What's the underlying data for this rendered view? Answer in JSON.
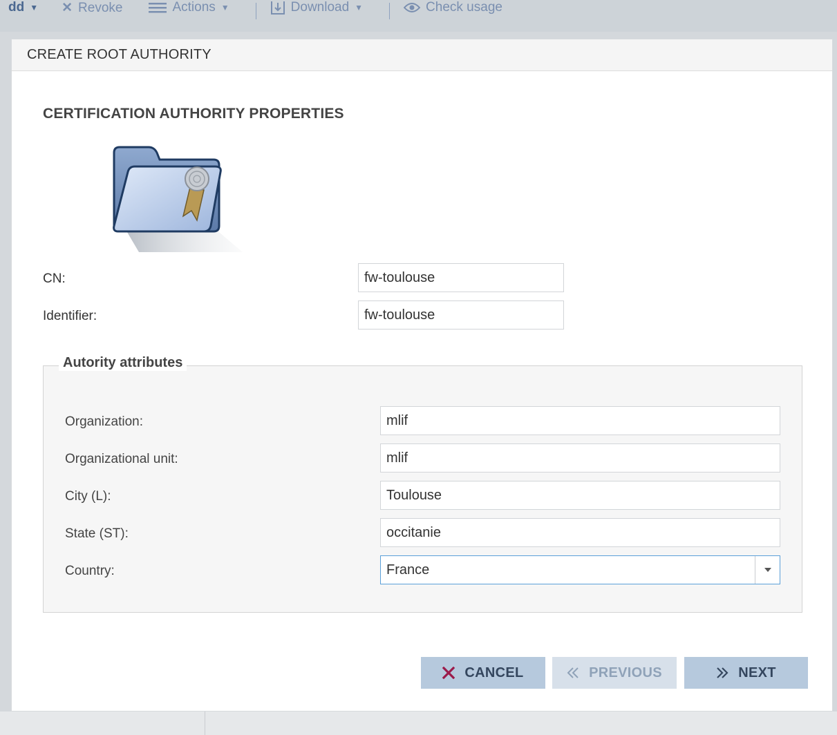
{
  "toolbar": {
    "add_label": "dd",
    "revoke_label": "Revoke",
    "actions_label": "Actions",
    "download_label": "Download",
    "check_usage_label": "Check usage"
  },
  "dialog": {
    "title": "CREATE ROOT AUTHORITY",
    "section_title": "CERTIFICATION AUTHORITY PROPERTIES",
    "icon": "certificate-folder-icon",
    "cn_label": "CN:",
    "cn_value": "fw-toulouse",
    "identifier_label": "Identifier:",
    "identifier_value": "fw-toulouse",
    "attributes": {
      "legend": "Autority attributes",
      "organization_label": "Organization:",
      "organization_value": "mlif",
      "org_unit_label": "Organizational unit:",
      "org_unit_value": "mlif",
      "city_label": "City (L):",
      "city_value": "Toulouse",
      "state_label": "State (ST):",
      "state_value": "occitanie",
      "country_label": "Country:",
      "country_value": "France"
    },
    "buttons": {
      "cancel": "CANCEL",
      "previous": "PREVIOUS",
      "next": "NEXT"
    }
  },
  "colors": {
    "accent_button": "#b6c9dd",
    "disabled_button": "#d7e0ea",
    "cancel_icon": "#9b1a4a",
    "focus_border": "#5a9fd8"
  }
}
